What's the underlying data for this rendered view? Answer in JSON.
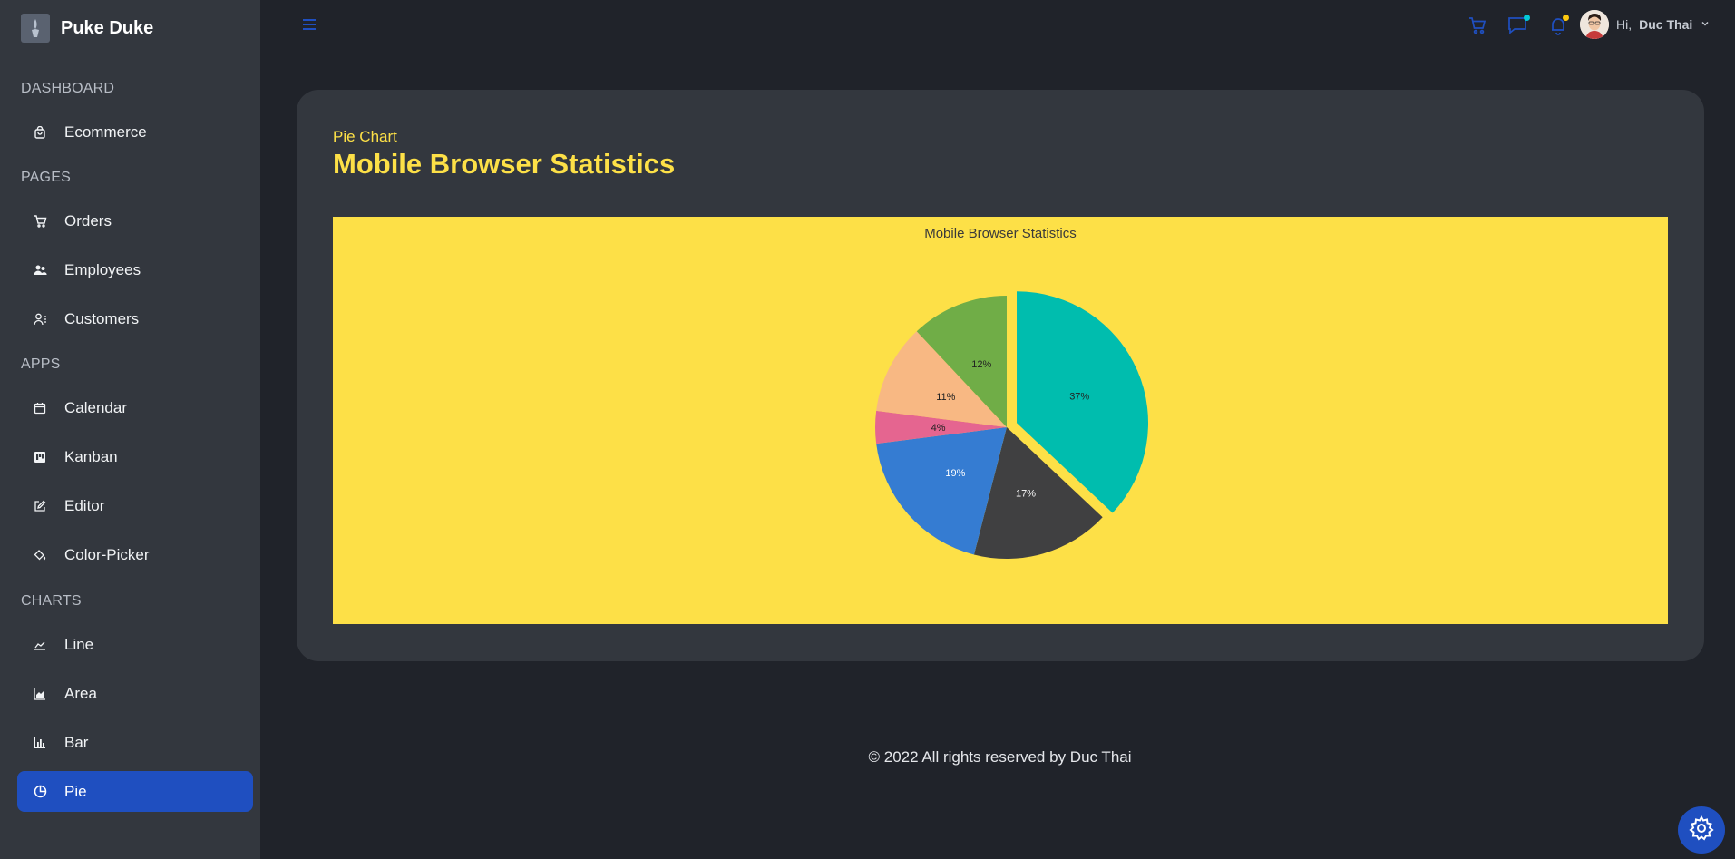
{
  "app": {
    "name": "Puke Duke",
    "accent": "#1f4fc0"
  },
  "sidebar": {
    "sections": [
      {
        "label": "DASHBOARD",
        "items": [
          {
            "label": "Ecommerce",
            "icon": "shopping-bag-icon"
          }
        ]
      },
      {
        "label": "PAGES",
        "items": [
          {
            "label": "Orders",
            "icon": "cart-icon"
          },
          {
            "label": "Employees",
            "icon": "people-icon"
          },
          {
            "label": "Customers",
            "icon": "user-icon"
          }
        ]
      },
      {
        "label": "APPS",
        "items": [
          {
            "label": "Calendar",
            "icon": "calendar-icon"
          },
          {
            "label": "Kanban",
            "icon": "kanban-icon"
          },
          {
            "label": "Editor",
            "icon": "edit-icon"
          },
          {
            "label": "Color-Picker",
            "icon": "paint-bucket-icon"
          }
        ]
      },
      {
        "label": "CHARTS",
        "items": [
          {
            "label": "Line",
            "icon": "line-chart-icon"
          },
          {
            "label": "Area",
            "icon": "area-chart-icon"
          },
          {
            "label": "Bar",
            "icon": "bar-chart-icon"
          },
          {
            "label": "Pie",
            "icon": "pie-chart-icon",
            "active": true
          }
        ]
      }
    ]
  },
  "topbar": {
    "greeting": "Hi,",
    "user_name": "Duc Thai",
    "icons": [
      "menu-icon",
      "cart-icon",
      "chat-icon",
      "bell-icon",
      "avatar",
      "chevron-down-icon"
    ],
    "chat_dot_color": "#03c9d7",
    "bell_dot_color": "#fec90f"
  },
  "card": {
    "subtitle": "Pie Chart",
    "title": "Mobile Browser Statistics"
  },
  "chart_data": {
    "type": "pie",
    "title": "Mobile Browser Statistics",
    "background": "#fde047",
    "slices": [
      {
        "label": "37%",
        "value": 37,
        "color": "#00bdae",
        "exploded": true
      },
      {
        "label": "17%",
        "value": 17,
        "color": "#404041"
      },
      {
        "label": "19%",
        "value": 19,
        "color": "#357cd2"
      },
      {
        "label": "4%",
        "value": 4,
        "color": "#e56590"
      },
      {
        "label": "11%",
        "value": 11,
        "color": "#f8b883"
      },
      {
        "label": "12%",
        "value": 12,
        "color": "#70ad47"
      }
    ]
  },
  "footer": {
    "text": "© 2022 All rights reserved by Duc Thai"
  }
}
